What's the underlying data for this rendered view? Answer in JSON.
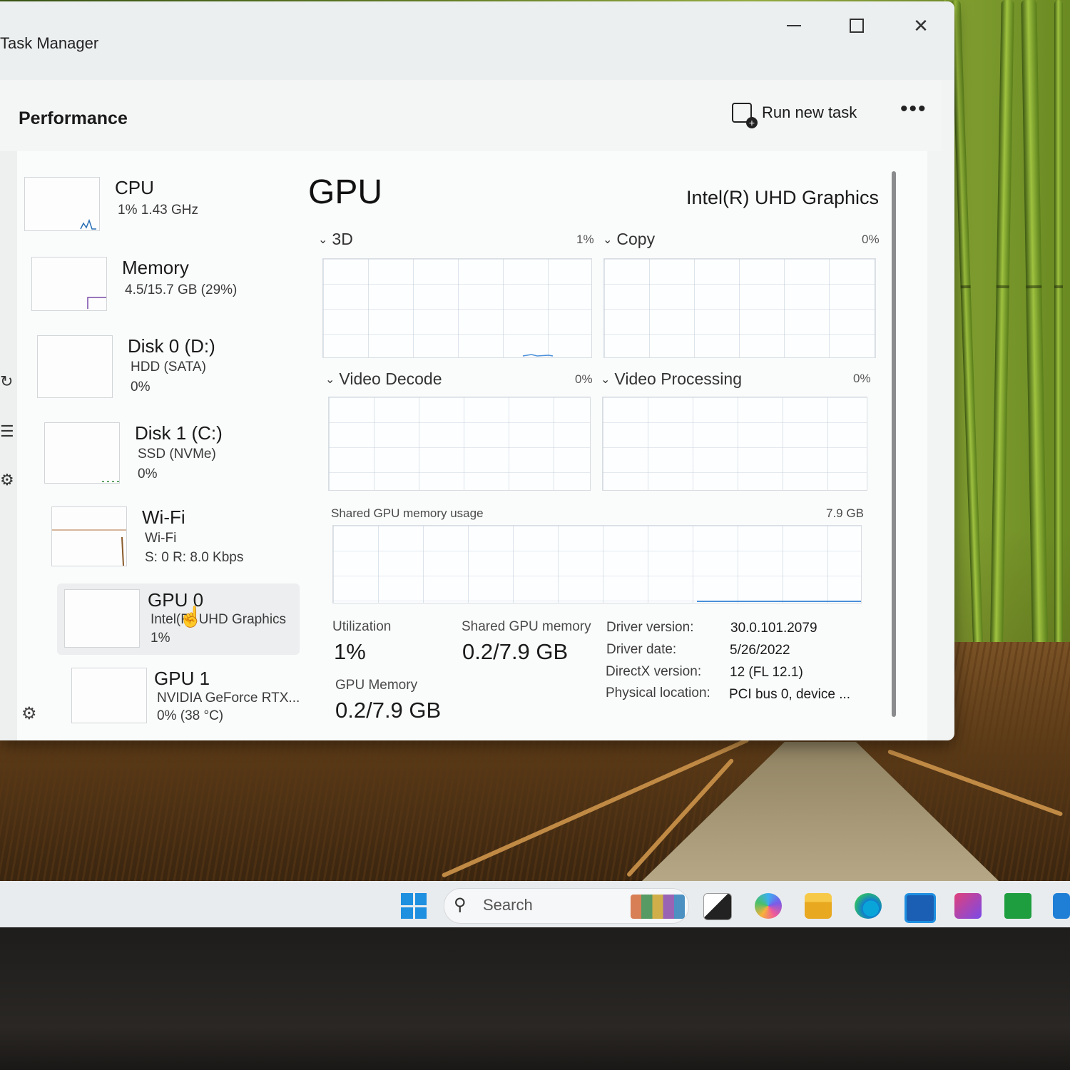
{
  "window": {
    "title": "Task Manager",
    "controls": {
      "minimize": "minimize-icon",
      "maximize": "maximize-icon",
      "close": "close-icon"
    }
  },
  "header": {
    "section_title": "Performance",
    "run_new_task": "Run new task",
    "more": "•••"
  },
  "sidebar": {
    "items": [
      {
        "name": "CPU",
        "lines": [
          "1%  1.43 GHz"
        ]
      },
      {
        "name": "Memory",
        "lines": [
          "4.5/15.7 GB (29%)"
        ]
      },
      {
        "name": "Disk 0 (D:)",
        "lines": [
          "HDD (SATA)",
          "0%"
        ]
      },
      {
        "name": "Disk 1 (C:)",
        "lines": [
          "SSD (NVMe)",
          "0%"
        ]
      },
      {
        "name": "Wi-Fi",
        "lines": [
          "Wi-Fi",
          "S: 0  R: 8.0 Kbps"
        ]
      },
      {
        "name": "GPU 0",
        "lines": [
          "Intel(R) UHD Graphics",
          "1%"
        ],
        "selected": true
      },
      {
        "name": "GPU 1",
        "lines": [
          "NVIDIA GeForce RTX...",
          "0%  (38 °C)"
        ]
      }
    ]
  },
  "main": {
    "title": "GPU",
    "model": "Intel(R) UHD Graphics",
    "engines": [
      {
        "label": "3D",
        "pct": "1%"
      },
      {
        "label": "Copy",
        "pct": "0%"
      },
      {
        "label": "Video Decode",
        "pct": "0%"
      },
      {
        "label": "Video Processing",
        "pct": "0%"
      }
    ],
    "shared_memory": {
      "label": "Shared GPU memory usage",
      "max": "7.9 GB"
    },
    "stats": {
      "utilization_label": "Utilization",
      "utilization_value": "1%",
      "shared_mem_label": "Shared GPU memory",
      "shared_mem_value": "0.2/7.9 GB",
      "gpu_mem_label": "GPU Memory",
      "gpu_mem_value": "0.2/7.9 GB"
    },
    "details": [
      {
        "key": "Driver version:",
        "value": "30.0.101.2079"
      },
      {
        "key": "Driver date:",
        "value": "5/26/2022"
      },
      {
        "key": "DirectX version:",
        "value": "12 (FL 12.1)"
      },
      {
        "key": "Physical location:",
        "value": "PCI bus 0, device ..."
      }
    ]
  },
  "taskbar": {
    "search_placeholder": "Search"
  },
  "colors": {
    "accent": "#1f8fe0",
    "graph_line": "#4a90d9",
    "window_bg": "#f2f3f3"
  }
}
